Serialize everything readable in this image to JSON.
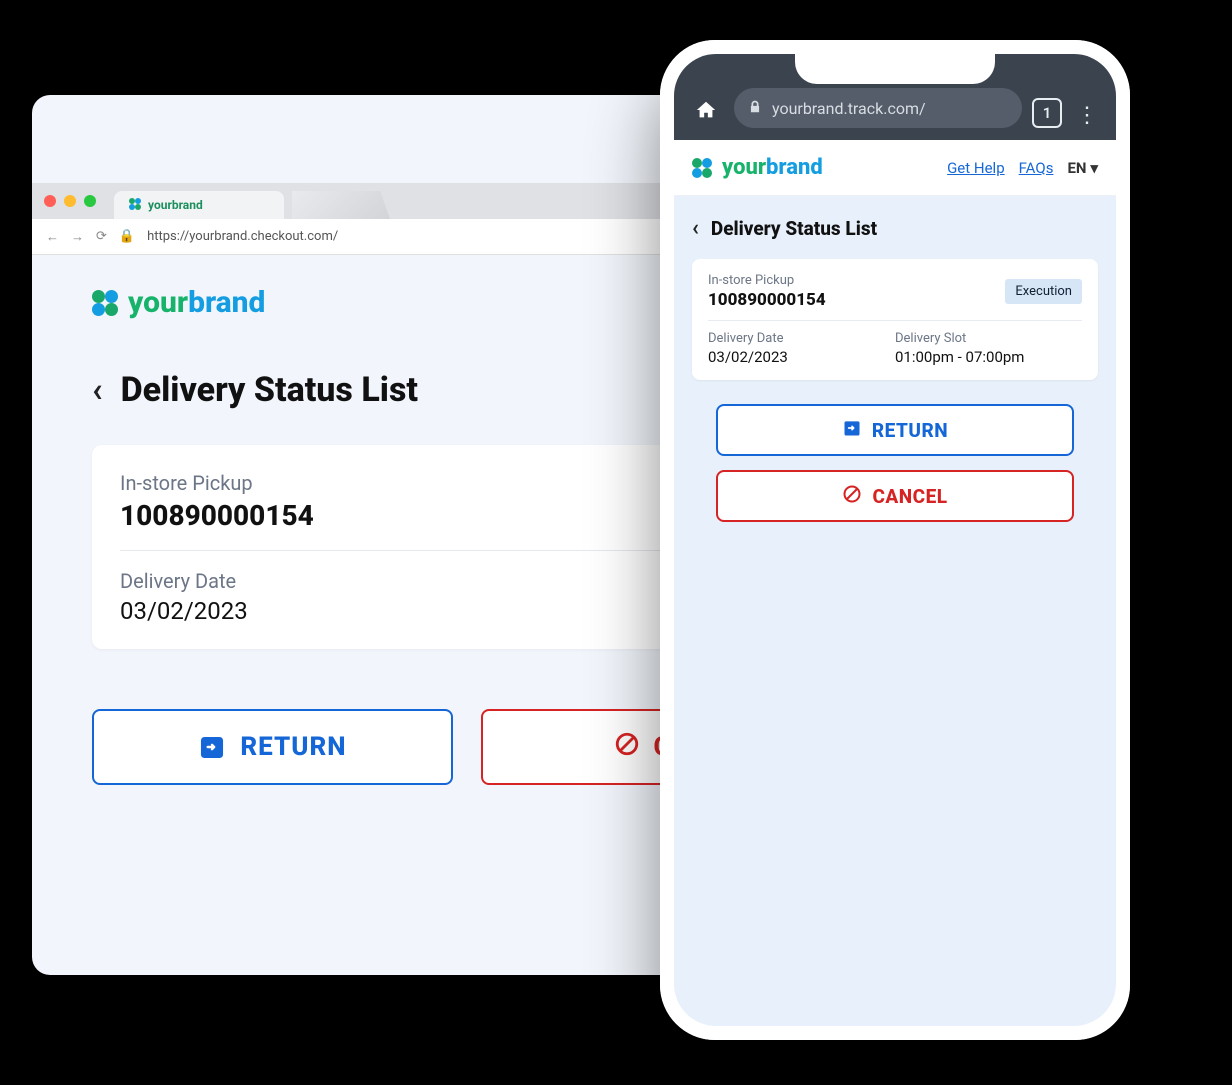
{
  "brand": {
    "your": "your",
    "brand": "brand"
  },
  "desktop": {
    "tab_label": "yourbrand",
    "url": "https://yourbrand.checkout.com/",
    "page_title": "Delivery Status List",
    "card": {
      "pickup_label": "In-store Pickup",
      "order_id": "100890000154",
      "status_badge": "Execution",
      "date_label": "Delivery Date",
      "date_value": "03/02/2023",
      "slot_label": "Delivery Slot",
      "slot_value": "01:00pm -"
    },
    "buttons": {
      "return": "RETURN",
      "cancel": "CAN"
    }
  },
  "mobile": {
    "url": "yourbrand.track.com/",
    "tab_count": "1",
    "links": {
      "help": "Get Help",
      "faqs": "FAQs",
      "lang": "EN"
    },
    "page_title": "Delivery Status List",
    "card": {
      "pickup_label": "In-store Pickup",
      "order_id": "100890000154",
      "status_badge": "Execution",
      "date_label": "Delivery Date",
      "date_value": "03/02/2023",
      "slot_label": "Delivery Slot",
      "slot_value": "01:00pm - 07:00pm"
    },
    "buttons": {
      "return": "RETURN",
      "cancel": "CANCEL"
    }
  },
  "colors": {
    "blue": "#1566d6",
    "red": "#d62323",
    "badge_bg": "#d6e6f7"
  }
}
